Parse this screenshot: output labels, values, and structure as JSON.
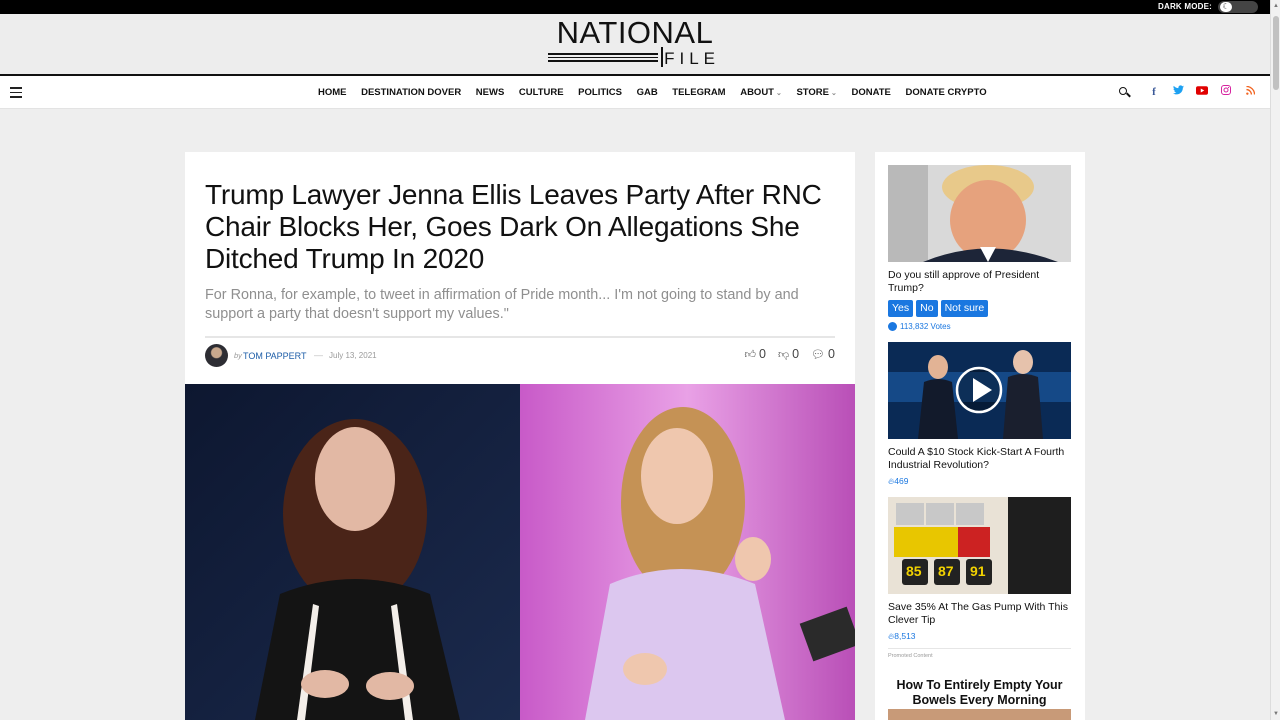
{
  "topbar": {
    "dark_mode_label": "DARK MODE:"
  },
  "logo": {
    "line1": "NATIONAL",
    "line2": "FILE"
  },
  "nav": {
    "items": [
      "HOME",
      "DESTINATION DOVER",
      "NEWS",
      "CULTURE",
      "POLITICS",
      "GAB",
      "TELEGRAM",
      "ABOUT",
      "STORE",
      "DONATE",
      "DONATE CRYPTO"
    ],
    "dropdown_items": [
      "ABOUT",
      "STORE"
    ],
    "social_icons": [
      "facebook-icon",
      "twitter-icon",
      "youtube-icon",
      "instagram-icon",
      "rss-icon"
    ]
  },
  "article": {
    "title": "Trump Lawyer Jenna Ellis Leaves Party After RNC Chair Blocks Her, Goes Dark On Allegations She Ditched Trump In 2020",
    "subtitle": "For Ronna, for example, to tweet in affirmation of Pride month... I'm not going to stand by and support a party that doesn't support my values.\"",
    "by_label": "by",
    "author": "TOM PAPPERT",
    "date": "July 13, 2021",
    "likes": "0",
    "dislikes": "0",
    "comments": "0"
  },
  "sidebar": {
    "poll": {
      "question": "Do you still approve of President Trump?",
      "options": [
        "Yes",
        "No",
        "Not sure"
      ],
      "votes": "113,832 Votes"
    },
    "promo1": {
      "title": "Could A $10 Stock Kick-Start A Fourth Industrial Revolution?",
      "count": "469"
    },
    "promo2": {
      "title": "Save 35% At The Gas Pump With This Clever Tip",
      "count": "8,513",
      "pump_numbers": [
        "85",
        "87",
        "91"
      ]
    },
    "promoted_label": "Promoted Content",
    "headline": "How To Entirely Empty Your Bowels Every Morning"
  },
  "colors": {
    "accent_blue": "#1a77e0",
    "author_link": "#1e5ea8",
    "facebook": "#3b5998",
    "twitter": "#1da1f2",
    "youtube": "#e00000",
    "instagram": "#d6249f",
    "rss": "#f26522"
  }
}
